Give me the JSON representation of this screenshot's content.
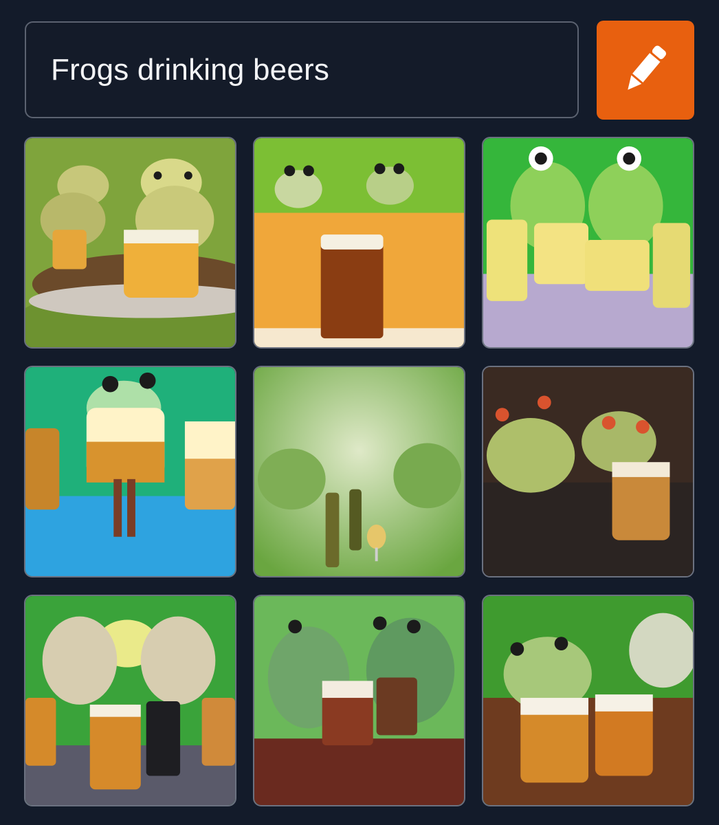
{
  "prompt": {
    "text": "Frogs drinking beers"
  },
  "edit_button": {
    "icon": "pencil-icon",
    "color": "#e8600f"
  },
  "gallery": {
    "images": [
      {
        "name": "generated-image-1"
      },
      {
        "name": "generated-image-2"
      },
      {
        "name": "generated-image-3"
      },
      {
        "name": "generated-image-4"
      },
      {
        "name": "generated-image-5"
      },
      {
        "name": "generated-image-6"
      },
      {
        "name": "generated-image-7"
      },
      {
        "name": "generated-image-8"
      },
      {
        "name": "generated-image-9"
      }
    ]
  }
}
